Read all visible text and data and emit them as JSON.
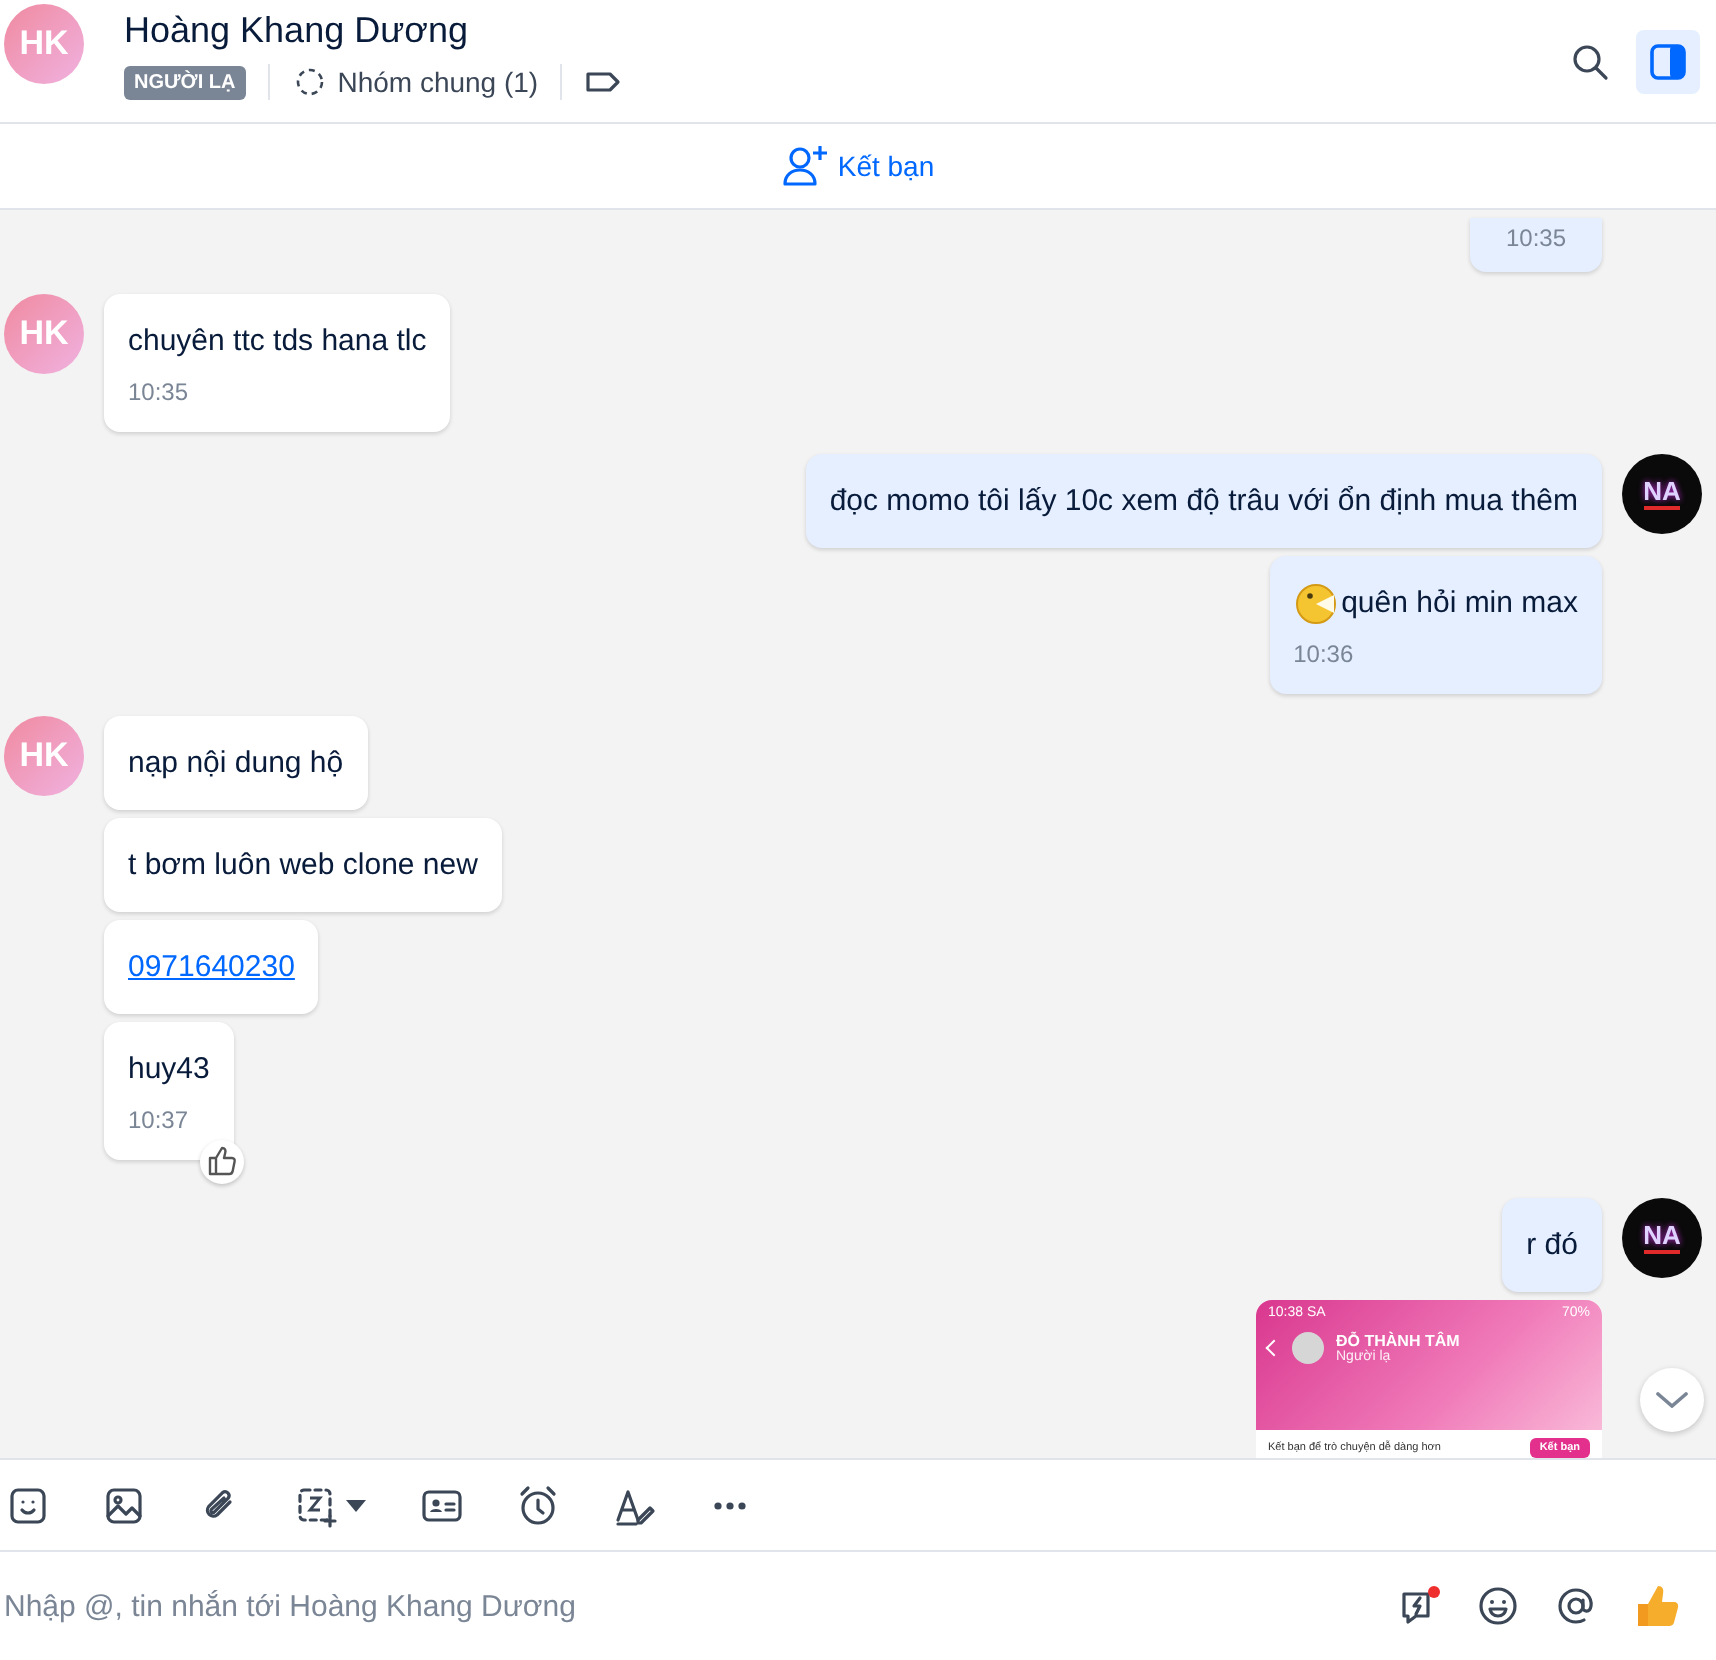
{
  "header": {
    "avatar": "HK",
    "name": "Hoàng Khang Dương",
    "tag": "NGƯỜI LẠ",
    "groups": "Nhóm chung (1)",
    "panel_toggle": {
      "selected": true
    }
  },
  "friend_bar": {
    "label": "Kết bạn"
  },
  "messages": [
    {
      "outgoing": true,
      "kind": "time_only",
      "time": "10:35",
      "liked": false
    },
    {
      "outgoing": false,
      "kind": "text",
      "avatar": "HK",
      "text": "chuyên ttc tds hana tlc",
      "time": "10:35",
      "liked": false
    },
    {
      "outgoing": true,
      "kind": "text",
      "avatar": "NA",
      "text": "đọc momo tôi lấy 10c xem độ trâu với ổn định mua thêm",
      "liked": false
    },
    {
      "outgoing": true,
      "kind": "emoji_text",
      "text": "quên hỏi min max",
      "time": "10:36",
      "liked": false
    },
    {
      "outgoing": false,
      "kind": "text",
      "avatar": "HK",
      "text": "nạp nội dung hộ",
      "liked": false
    },
    {
      "outgoing": false,
      "kind": "text",
      "text": "t bơm luôn web clone new",
      "liked": false
    },
    {
      "outgoing": false,
      "kind": "link",
      "text": "0971640230",
      "liked": false
    },
    {
      "outgoing": false,
      "kind": "text",
      "text": "huy43",
      "time": "10:37",
      "liked": true
    },
    {
      "outgoing": true,
      "kind": "text",
      "avatar": "NA",
      "text": "r đó",
      "liked": false
    },
    {
      "outgoing": true,
      "kind": "image",
      "shot": {
        "clock": "10:38 SA",
        "battery": "70%",
        "name": "ĐỖ THÀNH TÂM",
        "subtitle": "Người lạ",
        "prompt": "Kết bạn để trò chuyện dễ dàng hơn",
        "button": "Kết bạn"
      },
      "liked": false
    }
  ],
  "composer": {
    "placeholder": "Nhập @, tin nhắn tới Hoàng Khang Dương",
    "quick_message_alert": true
  }
}
